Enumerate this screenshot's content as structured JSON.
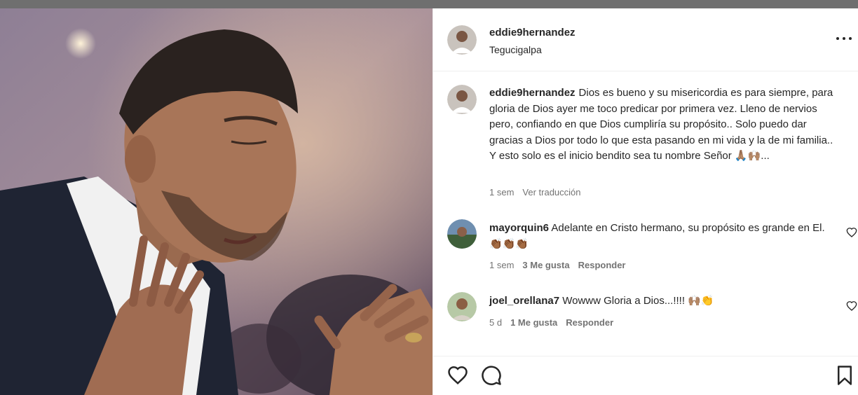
{
  "post": {
    "author": "eddie9hernandez",
    "location": "Tegucigalpa",
    "caption_text": "Dios es bueno y su misericordia es para siempre, para gloria de Dios ayer me toco predicar por primera vez. Lleno de nervios pero, confiando en que Dios cumpliría su propósito.. Solo puedo dar gracias a Dios por todo lo que esta pasando en mi vida y la de mi familia.. Y esto solo es el inicio bendito sea tu nombre Señor 🙏🏽🙌🏽...",
    "caption_time": "1 sem",
    "translate_label": "Ver traducción"
  },
  "comments": [
    {
      "user": "mayorquin6",
      "text": "Adelante en Cristo hermano, su propósito es grande en El. 👏🏾👏🏾👏🏾",
      "time": "1 sem",
      "likes": "3 Me gusta",
      "reply": "Responder"
    },
    {
      "user": "joel_orellana7",
      "text": "Wowww Gloria a Dios...!!!! 🙌🏽👏",
      "time": "5 d",
      "likes": "1 Me gusta",
      "reply": "Responder"
    }
  ],
  "icons": {
    "more": "more-options-icon",
    "like": "heart-icon",
    "comment": "comment-icon",
    "save": "bookmark-icon"
  },
  "colors": {
    "text": "#262626",
    "secondary": "#737373",
    "border": "#efefef"
  }
}
